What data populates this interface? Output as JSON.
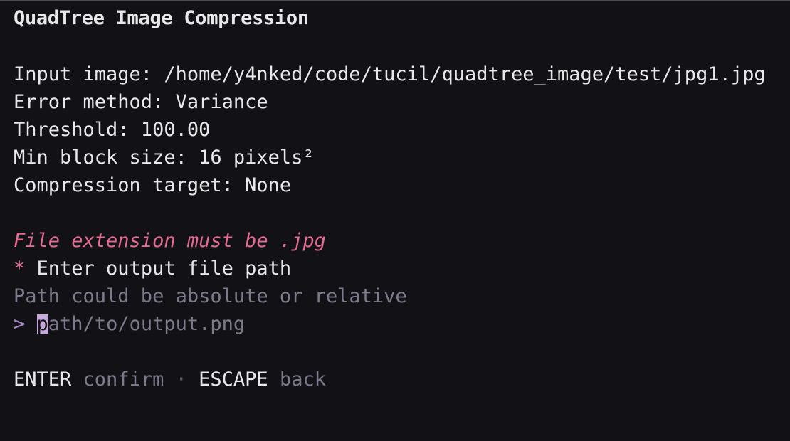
{
  "app": {
    "title": "QuadTree Image Compression"
  },
  "settings": {
    "input_image": "Input image: /home/y4nked/code/tucil/quadtree_image/test/jpg1.jpg",
    "error_method": "Error method: Variance",
    "threshold": "Threshold: 100.00",
    "min_block_size": "Min block size: 16 pixels²",
    "compression_target": "Compression target: None"
  },
  "prompt": {
    "error_message": "File extension must be .jpg",
    "star": "*",
    "question": " Enter output file path",
    "hint": "Path could be absolute or relative",
    "caret": ">",
    "placeholder_first": "p",
    "placeholder_rest": "ath/to/output.png"
  },
  "help": {
    "confirm_key": "ENTER",
    "confirm_desc": "confirm",
    "separator": "·",
    "back_key": "ESCAPE",
    "back_desc": "back"
  },
  "colors": {
    "background": "#121216",
    "text": "#e8e8ea",
    "error": "#e46a8f",
    "muted": "#7d7a8c",
    "cursor": "#c7a9d9"
  }
}
